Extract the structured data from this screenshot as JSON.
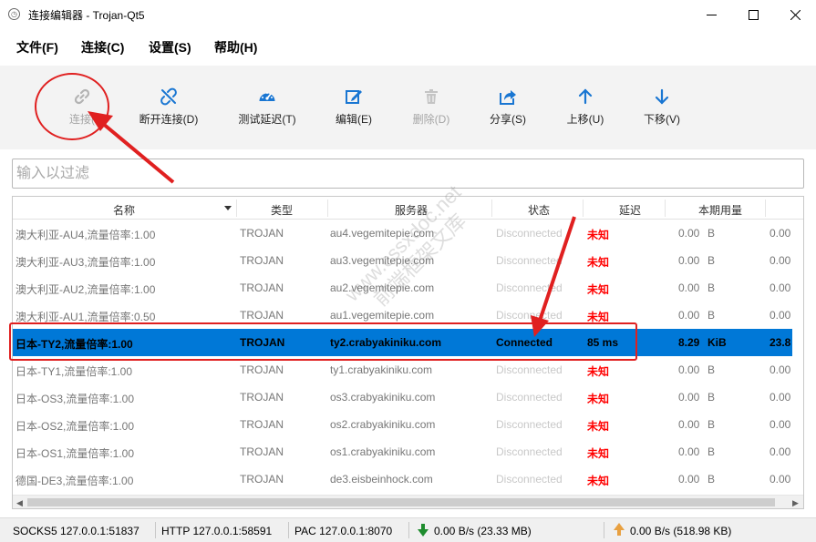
{
  "window": {
    "title": "连接编辑器 - Trojan-Qt5"
  },
  "menu": [
    "文件(F)",
    "连接(C)",
    "设置(S)",
    "帮助(H)"
  ],
  "toolbar": [
    {
      "label": "连接(",
      "icon": "link-icon",
      "disabled": true
    },
    {
      "label": "断开连接(D)",
      "icon": "unlink-icon",
      "disabled": false
    },
    {
      "label": "测试延迟(T)",
      "icon": "speedometer-icon",
      "disabled": false
    },
    {
      "label": "编辑(E)",
      "icon": "edit-icon",
      "disabled": false
    },
    {
      "label": "删除(D)",
      "icon": "trash-icon",
      "disabled": true
    },
    {
      "label": "分享(S)",
      "icon": "share-icon",
      "disabled": false
    },
    {
      "label": "上移(U)",
      "icon": "arrow-up-icon",
      "disabled": false
    },
    {
      "label": "下移(V)",
      "icon": "arrow-down-icon",
      "disabled": false
    }
  ],
  "filter": {
    "placeholder": "输入以过滤",
    "value": ""
  },
  "table": {
    "columns": [
      "名称",
      "类型",
      "服务器",
      "状态",
      "延迟",
      "本期用量"
    ],
    "rows": [
      {
        "name": "澳大利亚-AU4,流量倍率:1.00",
        "type": "TROJAN",
        "server": "au4.vegemitepie.com",
        "status": "Disconnected",
        "latency": "未知",
        "usage_value": "0.00",
        "usage_unit": "B",
        "extra": "0.00",
        "selected": false
      },
      {
        "name": "澳大利亚-AU3,流量倍率:1.00",
        "type": "TROJAN",
        "server": "au3.vegemitepie.com",
        "status": "Disconnected",
        "latency": "未知",
        "usage_value": "0.00",
        "usage_unit": "B",
        "extra": "0.00",
        "selected": false
      },
      {
        "name": "澳大利亚-AU2,流量倍率:1.00",
        "type": "TROJAN",
        "server": "au2.vegemitepie.com",
        "status": "Disconnected",
        "latency": "未知",
        "usage_value": "0.00",
        "usage_unit": "B",
        "extra": "0.00",
        "selected": false
      },
      {
        "name": "澳大利亚-AU1,流量倍率:0.50",
        "type": "TROJAN",
        "server": "au1.vegemitepie.com",
        "status": "Disconnected",
        "latency": "未知",
        "usage_value": "0.00",
        "usage_unit": "B",
        "extra": "0.00",
        "selected": false
      },
      {
        "name": "日本-TY2,流量倍率:1.00",
        "type": "TROJAN",
        "server": "ty2.crabyakiniku.com",
        "status": "Connected",
        "latency": "85 ms",
        "usage_value": "8.29",
        "usage_unit": "KiB",
        "extra": "23.8",
        "selected": true
      },
      {
        "name": "日本-TY1,流量倍率:1.00",
        "type": "TROJAN",
        "server": "ty1.crabyakiniku.com",
        "status": "Disconnected",
        "latency": "未知",
        "usage_value": "0.00",
        "usage_unit": "B",
        "extra": "0.00",
        "selected": false
      },
      {
        "name": "日本-OS3,流量倍率:1.00",
        "type": "TROJAN",
        "server": "os3.crabyakiniku.com",
        "status": "Disconnected",
        "latency": "未知",
        "usage_value": "0.00",
        "usage_unit": "B",
        "extra": "0.00",
        "selected": false
      },
      {
        "name": "日本-OS2,流量倍率:1.00",
        "type": "TROJAN",
        "server": "os2.crabyakiniku.com",
        "status": "Disconnected",
        "latency": "未知",
        "usage_value": "0.00",
        "usage_unit": "B",
        "extra": "0.00",
        "selected": false
      },
      {
        "name": "日本-OS1,流量倍率:1.00",
        "type": "TROJAN",
        "server": "os1.crabyakiniku.com",
        "status": "Disconnected",
        "latency": "未知",
        "usage_value": "0.00",
        "usage_unit": "B",
        "extra": "0.00",
        "selected": false
      },
      {
        "name": "德国-DE3,流量倍率:1.00",
        "type": "TROJAN",
        "server": "de3.eisbeinhock.com",
        "status": "Disconnected",
        "latency": "未知",
        "usage_value": "0.00",
        "usage_unit": "B",
        "extra": "0.00",
        "selected": false
      }
    ]
  },
  "watermark": {
    "line1": "www.cssxdoc.net",
    "line2": "前端框架文库"
  },
  "statusbar": {
    "socks": "SOCKS5   127.0.0.1:51837",
    "http": "HTTP   127.0.0.1:58591",
    "pac": "PAC   127.0.0.1:8070",
    "down": "0.00 B/s (23.33 MB)",
    "up": "0.00 B/s (518.98 KB)"
  },
  "colors": {
    "selection": "#0078d7",
    "latency_unknown": "#ff0000",
    "annotation": "#e02020",
    "arrow_down": "#1e8c2e",
    "arrow_up": "#e8a040"
  }
}
